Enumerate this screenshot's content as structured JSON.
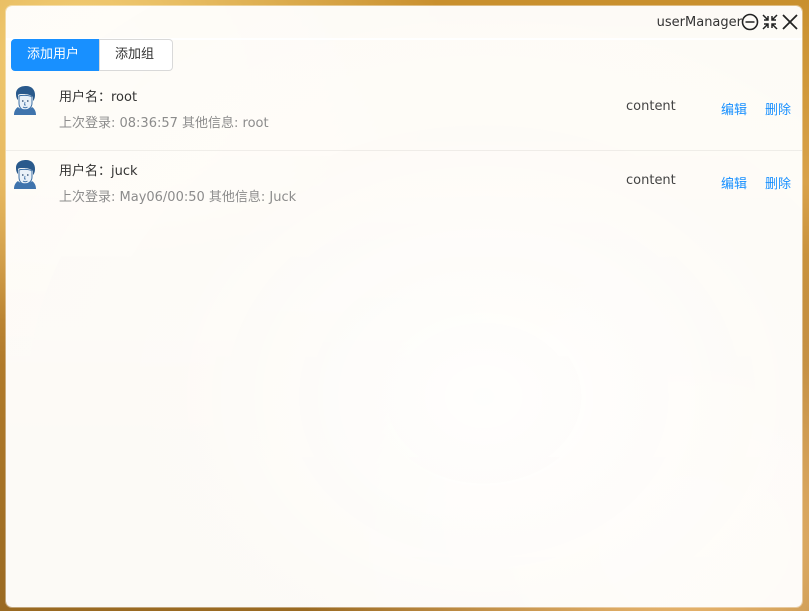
{
  "window": {
    "title": "userManager",
    "controls": {
      "minimize_icon": "minus-circle-icon",
      "restore_icon": "shrink-icon",
      "close_icon": "close-icon"
    }
  },
  "toolbar": {
    "add_user_label": "添加用户",
    "add_group_label": "添加组"
  },
  "users": [
    {
      "title": "用户名：root",
      "description": "上次登录: 08:36:57 其他信息: root",
      "content": "content",
      "edit_label": "编辑",
      "delete_label": "删除",
      "avatar_icon": "user-avatar-icon"
    },
    {
      "title": "用户名：juck",
      "description": "上次登录: May06/00:50 其他信息: Juck",
      "content": "content",
      "edit_label": "编辑",
      "delete_label": "删除",
      "avatar_icon": "user-avatar-icon"
    }
  ],
  "colors": {
    "primary": "#1890ff",
    "link": "#1890ff",
    "text": "#333333",
    "muted_text": "#8c8c8c"
  }
}
